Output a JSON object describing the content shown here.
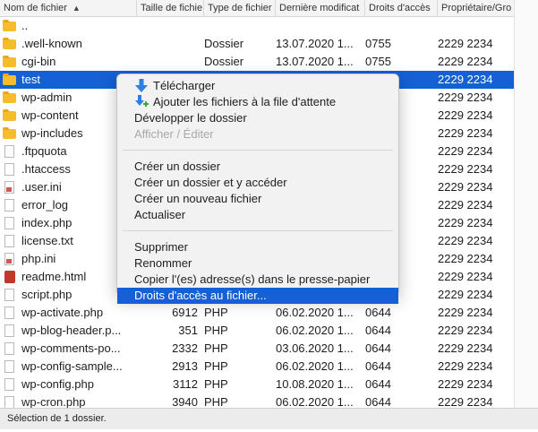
{
  "columns": [
    "Nom de fichier",
    "Taille de fichie",
    "Type de fichier",
    "Dernière modificat",
    "Droits d'accès",
    "Propriétaire/Gro"
  ],
  "files": [
    {
      "name": "..",
      "size": "",
      "type": "",
      "date": "",
      "perm": "",
      "owner": "",
      "icon": "folder"
    },
    {
      "name": ".well-known",
      "size": "",
      "type": "Dossier",
      "date": "13.07.2020 1...",
      "perm": "0755",
      "owner": "2229 2234",
      "icon": "folder"
    },
    {
      "name": "cgi-bin",
      "size": "",
      "type": "Dossier",
      "date": "13.07.2020 1...",
      "perm": "0755",
      "owner": "2229 2234",
      "icon": "folder"
    },
    {
      "name": "test",
      "size": "",
      "type": "",
      "date": "",
      "perm": "",
      "owner": "2229 2234",
      "icon": "folder",
      "selected": true
    },
    {
      "name": "wp-admin",
      "size": "",
      "type": "",
      "date": "",
      "perm": "",
      "owner": "2229 2234",
      "icon": "folder"
    },
    {
      "name": "wp-content",
      "size": "",
      "type": "",
      "date": "",
      "perm": "",
      "owner": "2229 2234",
      "icon": "folder"
    },
    {
      "name": "wp-includes",
      "size": "",
      "type": "",
      "date": "",
      "perm": "",
      "owner": "2229 2234",
      "icon": "folder"
    },
    {
      "name": ".ftpquota",
      "size": "",
      "type": "",
      "date": "",
      "perm": "",
      "owner": "2229 2234",
      "icon": "file"
    },
    {
      "name": ".htaccess",
      "size": "",
      "type": "",
      "date": "",
      "perm": "",
      "owner": "2229 2234",
      "icon": "file"
    },
    {
      "name": ".user.ini",
      "size": "",
      "type": "",
      "date": "",
      "perm": "",
      "owner": "2229 2234",
      "icon": "ini"
    },
    {
      "name": "error_log",
      "size": "",
      "type": "",
      "date": "",
      "perm": "",
      "owner": "2229 2234",
      "icon": "file"
    },
    {
      "name": "index.php",
      "size": "",
      "type": "",
      "date": "",
      "perm": "",
      "owner": "2229 2234",
      "icon": "file"
    },
    {
      "name": "license.txt",
      "size": "",
      "type": "",
      "date": "",
      "perm": "",
      "owner": "2229 2234",
      "icon": "file"
    },
    {
      "name": "php.ini",
      "size": "",
      "type": "",
      "date": "",
      "perm": "",
      "owner": "2229 2234",
      "icon": "ini"
    },
    {
      "name": "readme.html",
      "size": "",
      "type": "",
      "date": "",
      "perm": "",
      "owner": "2229 2234",
      "icon": "html"
    },
    {
      "name": "script.php",
      "size": "",
      "type": "",
      "date": "",
      "perm": "",
      "owner": "2229 2234",
      "icon": "file"
    },
    {
      "name": "wp-activate.php",
      "size": "6912",
      "type": "PHP",
      "date": "06.02.2020 1...",
      "perm": "0644",
      "owner": "2229 2234",
      "icon": "file"
    },
    {
      "name": "wp-blog-header.p...",
      "size": "351",
      "type": "PHP",
      "date": "06.02.2020 1...",
      "perm": "0644",
      "owner": "2229 2234",
      "icon": "file"
    },
    {
      "name": "wp-comments-po...",
      "size": "2332",
      "type": "PHP",
      "date": "03.06.2020 1...",
      "perm": "0644",
      "owner": "2229 2234",
      "icon": "file"
    },
    {
      "name": "wp-config-sample...",
      "size": "2913",
      "type": "PHP",
      "date": "06.02.2020 1...",
      "perm": "0644",
      "owner": "2229 2234",
      "icon": "file"
    },
    {
      "name": "wp-config.php",
      "size": "3112",
      "type": "PHP",
      "date": "10.08.2020 1...",
      "perm": "0644",
      "owner": "2229 2234",
      "icon": "file"
    },
    {
      "name": "wp-cron.php",
      "size": "3940",
      "type": "PHP",
      "date": "06.02.2020 1...",
      "perm": "0644",
      "owner": "2229 2234",
      "icon": "file"
    }
  ],
  "menu": {
    "download": "Télécharger",
    "add_queue": "Ajouter les fichiers à la file d'attente",
    "expand": "Développer le dossier",
    "view_edit": "Afficher / Éditer",
    "create_dir": "Créer un dossier",
    "create_dir_enter": "Créer un dossier et y accéder",
    "new_file": "Créer un nouveau fichier",
    "refresh": "Actualiser",
    "delete": "Supprimer",
    "rename": "Renommer",
    "copy_urls": "Copier l'(es) adresse(s) dans le presse-papier",
    "permissions": "Droits d'accès au fichier..."
  },
  "status": "Sélection de 1 dossier.",
  "colors": {
    "selection": "#1560d4",
    "folder": "#f5bd2c"
  }
}
